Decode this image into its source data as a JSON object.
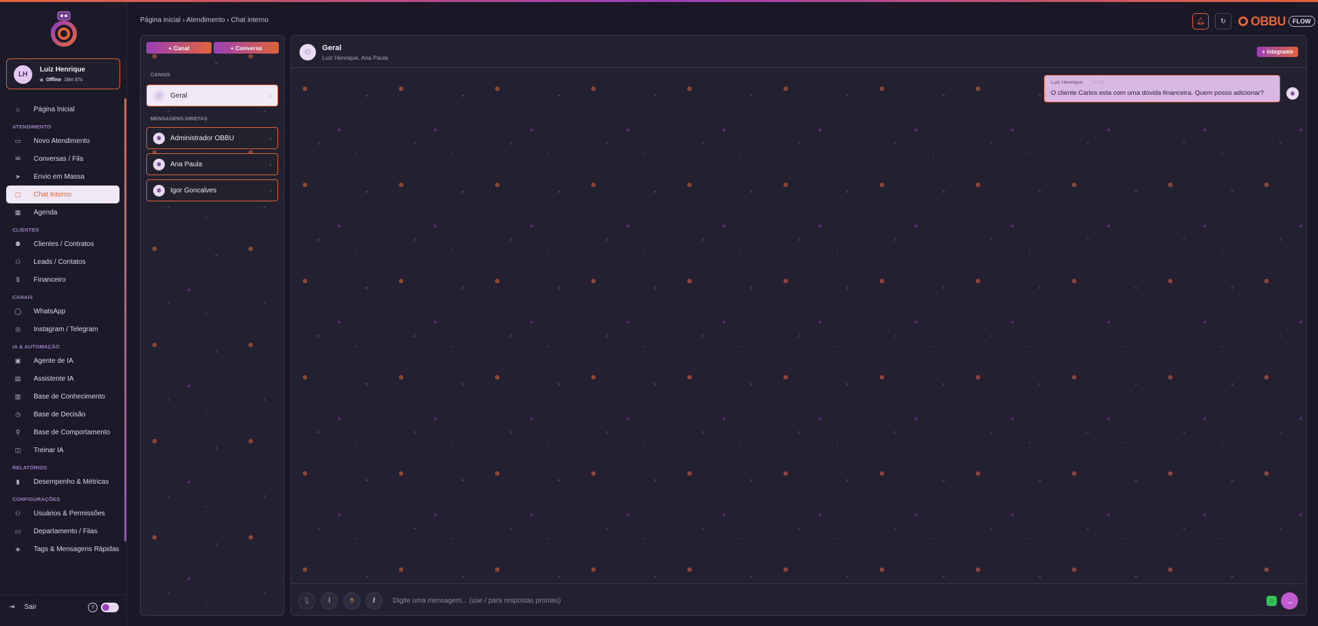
{
  "colors": {
    "accent_orange": "#e0643a",
    "accent_purple": "#9b3fb8",
    "background": "#1a1826",
    "message_bubble": "#d9b8e3"
  },
  "sidebar": {
    "logo_icon": "obbu-robot-logo-icon",
    "user": {
      "initials": "LH",
      "name": "Luiz Henrique",
      "status": "Offline",
      "duration": "18m 37s"
    },
    "nav": [
      {
        "type": "item",
        "label": "Página Inicial",
        "icon": "home-icon"
      },
      {
        "type": "section",
        "label": "ATENDIMENTO"
      },
      {
        "type": "item",
        "label": "Novo Atendimento",
        "icon": "message-plus-icon"
      },
      {
        "type": "item",
        "label": "Conversas / Fila",
        "icon": "inbox-icon"
      },
      {
        "type": "item",
        "label": "Envio em Massa",
        "icon": "send-icon"
      },
      {
        "type": "item",
        "label": "Chat Interno",
        "icon": "chat-icon",
        "active": true
      },
      {
        "type": "item",
        "label": "Agenda",
        "icon": "calendar-icon"
      },
      {
        "type": "section",
        "label": "CLIENTES"
      },
      {
        "type": "item",
        "label": "Clientes / Contratos",
        "icon": "user-icon"
      },
      {
        "type": "item",
        "label": "Leads / Contatos",
        "icon": "user-plus-icon"
      },
      {
        "type": "item",
        "label": "Financeiro",
        "icon": "dollar-icon"
      },
      {
        "type": "section",
        "label": "CANAIS"
      },
      {
        "type": "item",
        "label": "WhatsApp",
        "icon": "whatsapp-icon"
      },
      {
        "type": "item",
        "label": "Instagram / Telegram",
        "icon": "instagram-icon"
      },
      {
        "type": "section",
        "label": "IA & AUTOMAÇÃO"
      },
      {
        "type": "item",
        "label": "Agente de IA",
        "icon": "robot-icon"
      },
      {
        "type": "item",
        "label": "Assistente IA",
        "icon": "assistant-icon"
      },
      {
        "type": "item",
        "label": "Base de Conhecimento",
        "icon": "book-icon"
      },
      {
        "type": "item",
        "label": "Base de Decisão",
        "icon": "decision-icon"
      },
      {
        "type": "item",
        "label": "Base de Comportamento",
        "icon": "behavior-icon"
      },
      {
        "type": "item",
        "label": "Treinar IA",
        "icon": "training-icon"
      },
      {
        "type": "section",
        "label": "RELATÓRIOS"
      },
      {
        "type": "item",
        "label": "Desempenho & Métricas",
        "icon": "bar-chart-icon"
      },
      {
        "type": "section",
        "label": "CONFIGURAÇÕES"
      },
      {
        "type": "item",
        "label": "Usuários & Permissões",
        "icon": "users-icon"
      },
      {
        "type": "item",
        "label": "Departamento / Filas",
        "icon": "briefcase-icon"
      },
      {
        "type": "item",
        "label": "Tags & Mensagens Rápidas",
        "icon": "tag-icon"
      }
    ],
    "logout_label": "Sair",
    "help_label": "?"
  },
  "header": {
    "breadcrumb": "Página inicial › Atendimento › Chat interno",
    "notification_icon": "bell-icon",
    "refresh_icon": "refresh-icon",
    "brand_name": "OBBU",
    "brand_tag": "FLOW"
  },
  "channels_panel": {
    "new_channel_label": "+ Canal",
    "new_conversation_label": "+ Conversa",
    "channels_heading": "CANAIS",
    "channels": [
      {
        "name": "Geral",
        "active": true
      }
    ],
    "dm_heading": "MENSAGENS DIRETAS",
    "direct_messages": [
      {
        "name": "Administrador OBBU"
      },
      {
        "name": "Ana Paula"
      },
      {
        "name": "Igor Goncalves"
      }
    ]
  },
  "chat": {
    "title": "Geral",
    "members": "Luiz Henrique, Ana Paula",
    "add_member_label": "+ Integrante",
    "messages": [
      {
        "author": "Luiz Henrique",
        "time": "14:39",
        "text": "O cliente Carlos esta com uma dúvida financeira. Quem posso adicionar?"
      }
    ],
    "composer": {
      "placeholder": "Digite uma mensagem... (use / para respostas prontas)",
      "slash_label": "/"
    }
  }
}
